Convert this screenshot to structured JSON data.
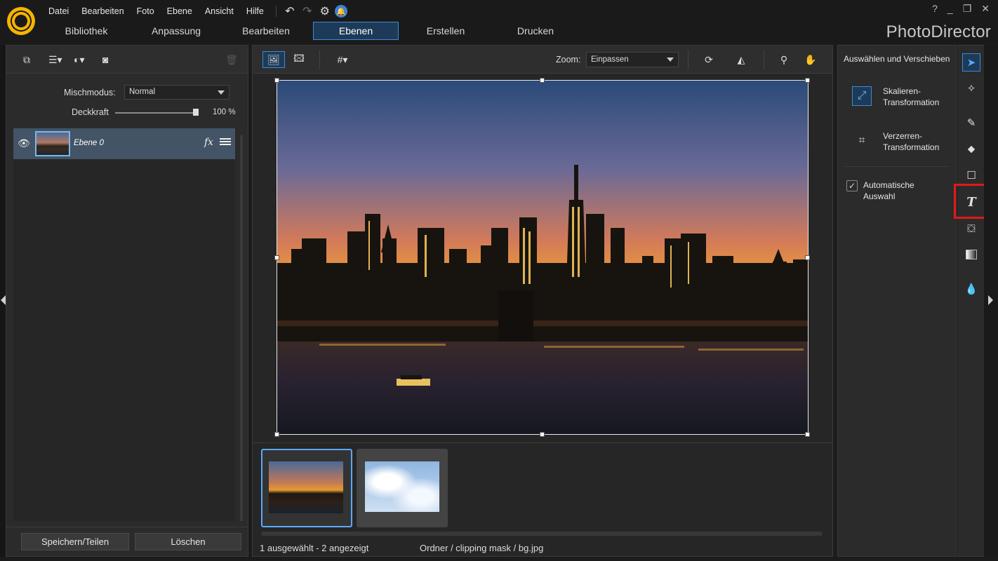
{
  "menu": [
    "Datei",
    "Bearbeiten",
    "Foto",
    "Ebene",
    "Ansicht",
    "Hilfe"
  ],
  "window_controls": [
    "?",
    "_",
    "❐",
    "✕"
  ],
  "tabs": [
    {
      "label": "Bibliothek",
      "active": false
    },
    {
      "label": "Anpassung",
      "active": false
    },
    {
      "label": "Bearbeiten",
      "active": false
    },
    {
      "label": "Ebenen",
      "active": true
    },
    {
      "label": "Erstellen",
      "active": false
    },
    {
      "label": "Drucken",
      "active": false
    }
  ],
  "app_title": "PhotoDirector",
  "layers_panel": {
    "blend_mode_label": "Mischmodus:",
    "blend_mode_value": "Normal",
    "opacity_label": "Deckkraft",
    "opacity_value": "100 %",
    "opacity_fraction": 1.0,
    "layer_name": "Ebene 0",
    "fx_label": "fx",
    "save_share_button": "Speichern/Teilen",
    "delete_button": "Löschen"
  },
  "canvas": {
    "zoom_label": "Zoom:",
    "zoom_value": "Einpassen"
  },
  "status": {
    "selection": "1 ausgewählt - 2 angezeigt",
    "path": "Ordner / clipping mask / bg.jpg"
  },
  "right_panel": {
    "title": "Auswählen und Verschieben",
    "scale_transform": [
      "Skalieren-",
      "Transformation"
    ],
    "distort_transform": [
      "Verzerren-",
      "Transformation"
    ],
    "auto_select": [
      "Automatische",
      "Auswahl"
    ],
    "auto_select_checked": true
  },
  "colors": {
    "accent": "#3d8ad6",
    "active_tab_bg": "#1d3b58",
    "highlight_box": "#e01818",
    "bell": "#3b7fe0"
  },
  "icons": {
    "tools": [
      "arrow-pointer-icon",
      "brush-stamp-icon",
      "pen-icon",
      "eraser-icon",
      "rectangle-icon",
      "text-icon",
      "paint-bucket-icon",
      "gradient-icon",
      "droplet-icon"
    ]
  }
}
